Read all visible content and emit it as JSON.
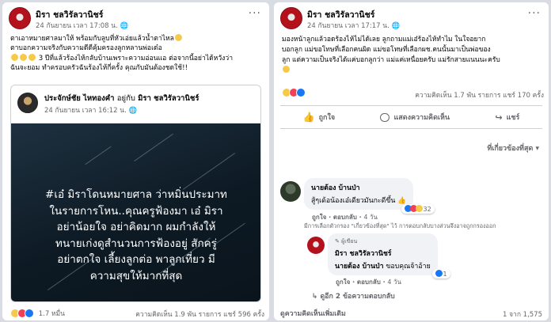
{
  "left_post": {
    "author": "มิรา ชลวิรัลวานิชร์",
    "date": "24 กันยายน เวลา 17:08 น.",
    "privacy_icon": "globe-icon",
    "text_lines": [
      "ตาเอาหมายศาลมาให้ พร้อมกับลูบที่หัวเอ่ยแล้วน้ำตาไหล",
      "ตาบอกความจริงกับความดีดีคุ้มครองลูกหลานพ่อเด๋อ",
      "3 ปีที่แล้วร้องไห้กลับบ้านเพราะความอ่อนแอ ต่อจากนี้อย่าได้หวังว่า",
      "ฉันจะยอม ทำครอบครัวฉันร้องไห้กี่ครั้ง คุณกับมันต้องชดใช้!!"
    ],
    "shared": {
      "author": "ประจักษ์ชัย ไหทองคำ",
      "with_label": "อยู่กับ",
      "with_name": "มิรา ชลวิรัลวานิชร์",
      "date": "24 กันยายน เวลา 16:12 น.",
      "image_text_lines": [
        "#เอ๋ มิราโดนหมายศาล ว่าหมิ่นประมาท",
        "ในรายการโหน..คุณครูฟ้องมา เอ๋ มิรา",
        "อย่าน้อยใจ อย่าคิดมาก ผมกำลังให้",
        "ทนายเก่งดูสำนวนการฟ้องอยู่ สักครู่",
        "อย่าตกใจ เลี้ยงลูกต่อ พาลูกเที่ยว มี",
        "ความสุขให้มากที่สุด"
      ]
    },
    "reactions_count": "1.7 หมื่น",
    "stats": "ความคิดเห็น 1.9 พัน รายการ  แชร์ 596 ครั้ง"
  },
  "right_post": {
    "author": "มิรา ชลวิรัลวานิชร์",
    "date": "24 กันยายน เวลา 17:17 น.",
    "privacy_icon": "globe-icon",
    "text_lines": [
      "มองหน้าลูกแล้วอดร้องไห้ไม่ได้เลย ลูกถามแม่เอ๋ร้องไห้ทำไม ในใจอยาก",
      "บอกลูก แม่ขอโทษที่เลือกคนผิด แม่ขอโทษที่เลือกผช.คนนั้นมาเป็นพ่อของ",
      "ลูก แต่ความเป็นจริงได้แค่บอกลูกว่า แม่แค่เหนื่อยครับ แม่รักสายแนนนะครับ"
    ],
    "reactions_count": "",
    "stats": "ความคิดเห็น 1.7 พัน รายการ  แชร์ 170 ครั้ง",
    "actions": {
      "like": "ถูกใจ",
      "comment": "แสดงความคิดเห็น",
      "share": "แชร์"
    },
    "filter_label": "ที่เกี่ยวข้องที่สุด",
    "comments": [
      {
        "name": "นายต้อง บ้านป่า",
        "text": "สู้ๆเด้อน้องเอ๋เดียวมันกะดีขึ้น",
        "like": "ถูกใจ",
        "reply": "ตอบกลับ",
        "time": "4 วัน",
        "react_count": "32",
        "note": "มีการเลือกตัวกรอง \"เกี่ยวข้องที่สุด\" ไว้ การตอบกลับบางส่วนจึงอาจถูกกรองออก"
      }
    ],
    "reply": {
      "badge": "ผู้เขียน",
      "name": "มิรา ชลวิรัลวานิชร์",
      "mention": "นายต้อง บ้านป่า",
      "text": "ขอบคุณจ้าอ้าย",
      "like": "ถูกใจ",
      "reply": "ตอบกลับ",
      "time": "4 วัน",
      "react_count": "1"
    },
    "more_replies": "ดูอีก 2 ข้อความตอบกลับ",
    "more_comments": "ดูความคิดเห็นเพิ่มเติม",
    "pagination": "1 จาก 1,575"
  }
}
